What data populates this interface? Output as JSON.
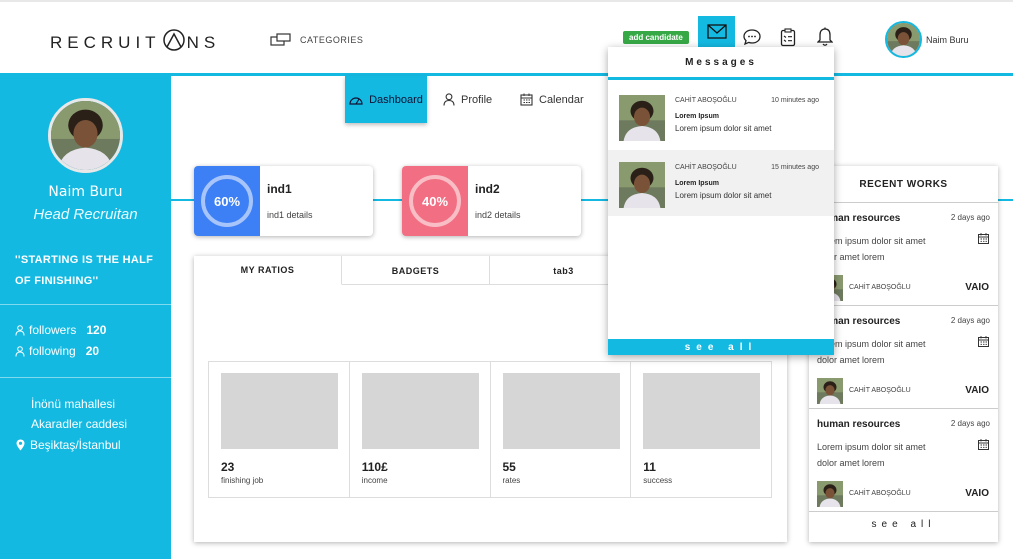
{
  "brand": {
    "logo_prefix": "RECRUIT",
    "logo_suffix": "NS"
  },
  "header": {
    "categories_label": "CATEGORIES",
    "add_candidate_label": "add candidate",
    "user_name": "Naim Buru"
  },
  "sidebar": {
    "name": "Naim Buru",
    "role": "Head Recruitan",
    "quote": "''STARTING IS THE HALF OF FINISHING''",
    "followers_label": "followers",
    "followers_count": "120",
    "following_label": "following",
    "following_count": "20",
    "address_line1": "İnönü mahallesi",
    "address_line2": "Akaradler caddesi",
    "address_line3": "Beşiktaş/İstanbul"
  },
  "nav": {
    "dashboard": "Dashboard",
    "profile": "Profile",
    "calendar": "Calendar"
  },
  "indicators": [
    {
      "title": "ind1",
      "details": "ind1 details",
      "percent_label": "60%",
      "percent": 60,
      "color": "#3d7ff5"
    },
    {
      "title": "ind2",
      "details": "ind2 details",
      "percent_label": "40%",
      "percent": 40,
      "color": "#f26e82"
    }
  ],
  "tabs": [
    "MY RATIOS",
    "BADGETS",
    "tab3"
  ],
  "stats": [
    {
      "value": "23",
      "label": "finishing job"
    },
    {
      "value": "110£",
      "label": "income"
    },
    {
      "value": "55",
      "label": "rates"
    },
    {
      "value": "11",
      "label": "success"
    }
  ],
  "recent_works": {
    "title": "RECENT WORKS",
    "see_all": "see all",
    "items": [
      {
        "title": "human resources",
        "time": "2 days ago",
        "desc": "Lorem ipsum dolor sit amet dolor amet lorem",
        "person": "CAHİT ABOŞOĞLU",
        "company": "VAIO"
      },
      {
        "title": "human resources",
        "time": "2 days ago",
        "desc": "Lorem ipsum dolor sit amet dolor amet lorem",
        "person": "CAHİT ABOŞOĞLU",
        "company": "VAIO"
      },
      {
        "title": "human resources",
        "time": "2 days ago",
        "desc": "Lorem ipsum dolor sit amet dolor amet lorem",
        "person": "CAHİT ABOŞOĞLU",
        "company": "VAIO"
      }
    ]
  },
  "messages": {
    "title": "Messages",
    "see_all": "see all",
    "items": [
      {
        "name": "CAHİT ABOŞOĞLU",
        "time": "10 minutes ago",
        "subject": "Lorem Ipsum",
        "body": "Lorem ipsum dolor sit amet"
      },
      {
        "name": "CAHİT ABOŞOĞLU",
        "time": "15 minutes ago",
        "subject": "Lorem Ipsum",
        "body": "Lorem ipsum dolor sit amet"
      }
    ]
  },
  "colors": {
    "accent": "#14b9e1",
    "success": "#37a846",
    "ind1": "#3d7ff5",
    "ind2": "#f26e82"
  }
}
